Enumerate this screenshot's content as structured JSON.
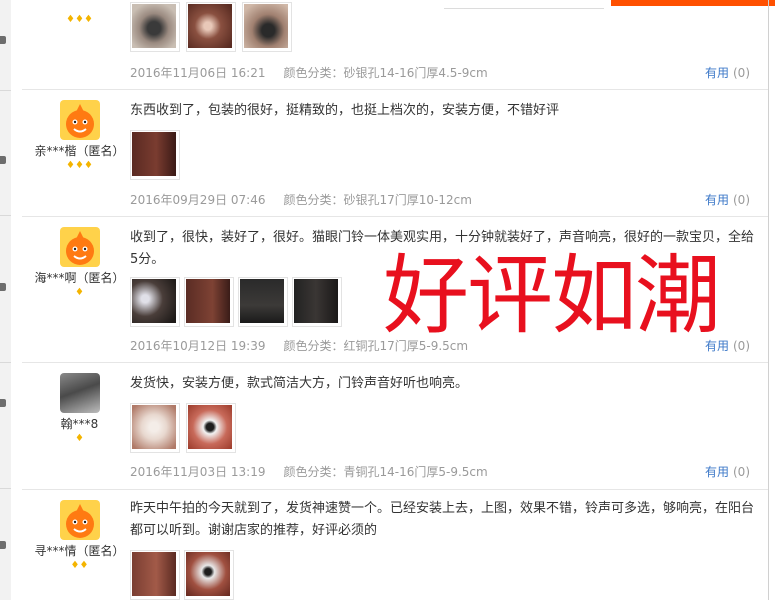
{
  "reviews": [
    {
      "user": "",
      "badges": "♦♦♦",
      "text": "",
      "date": "2016年11月06日 16:21",
      "sku": "颜色分类：砂银孔14-16门厚4.5-9cm",
      "useful_label": "有用",
      "useful_count": "(0)"
    },
    {
      "user": "亲***楷（匿名）",
      "badges": "♦♦♦",
      "text": "东西收到了，包装的很好，挺精致的，也挺上档次的，安装方便，不错好评",
      "date": "2016年09月29日 07:46",
      "sku": "颜色分类：砂银孔17门厚10-12cm",
      "useful_label": "有用",
      "useful_count": "(0)"
    },
    {
      "user": "海***啊（匿名）",
      "badges": "♦",
      "text": "收到了，很快，装好了，很好。猫眼门铃一体美观实用，十分钟就装好了，声音响亮，很好的一款宝贝，全给5分。",
      "date": "2016年10月12日 19:39",
      "sku": "颜色分类：红铜孔17门厚5-9.5cm",
      "useful_label": "有用",
      "useful_count": "(0)"
    },
    {
      "user": "翰***8",
      "badges": "♦",
      "text": "发货快，安装方便，款式简洁大方，门铃声音好听也响亮。",
      "date": "2016年11月03日 13:19",
      "sku": "颜色分类：青铜孔14-16门厚5-9.5cm",
      "useful_label": "有用",
      "useful_count": "(0)"
    },
    {
      "user": "寻***情（匿名）",
      "badges": "♦♦",
      "text": "昨天中午拍的今天就到了，发货神速赞一个。已经安装上去，上图，效果不错，铃声可多选，够响亮，在阳台都可以听到。谢谢店家的推荐，好评必须的",
      "date": "",
      "sku": "",
      "useful_label": "",
      "useful_count": ""
    }
  ],
  "overlay": "好评如潮",
  "colors": {
    "accent": "#ff5000",
    "link": "#3c78c8",
    "overlay": "#e8101e",
    "badge": "#f4b400"
  }
}
